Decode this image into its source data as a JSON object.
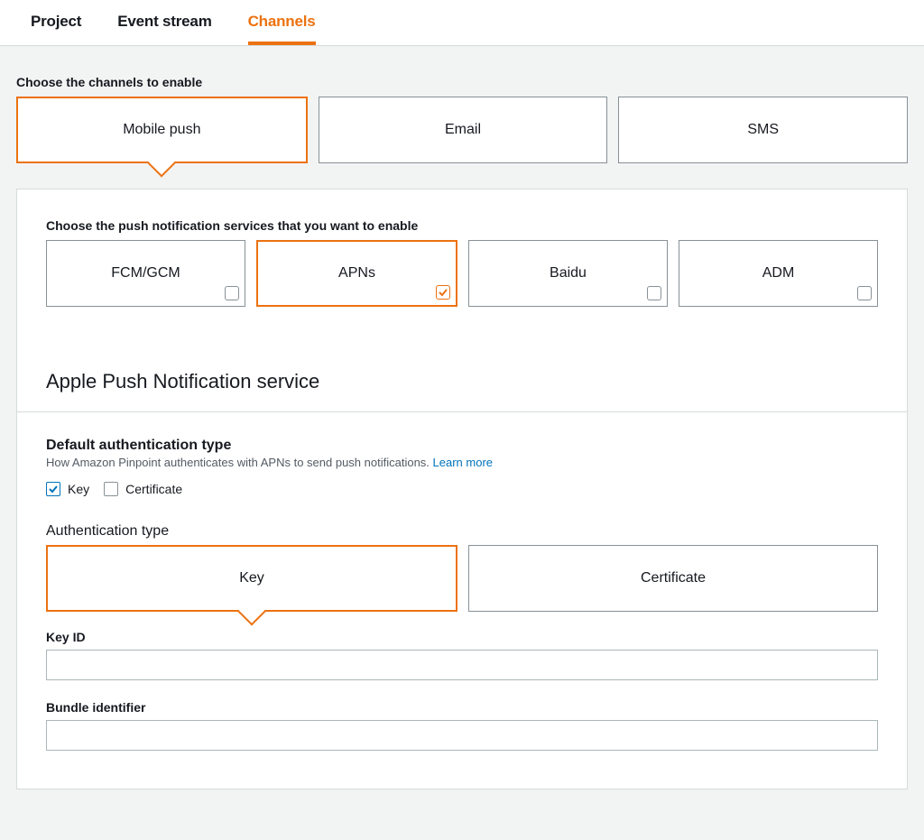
{
  "tabs": {
    "project": "Project",
    "event_stream": "Event stream",
    "channels": "Channels"
  },
  "channels": {
    "heading": "Choose the channels to enable",
    "mobile_push": "Mobile push",
    "email": "Email",
    "sms": "SMS"
  },
  "push_services": {
    "heading": "Choose the push notification services that you want to enable",
    "fcm": "FCM/GCM",
    "apns": "APNs",
    "baidu": "Baidu",
    "adm": "ADM"
  },
  "apns_section": {
    "title": "Apple Push Notification service",
    "default_auth_heading": "Default authentication type",
    "default_auth_desc": "How Amazon Pinpoint authenticates with APNs to send push notifications. ",
    "learn_more": "Learn more",
    "key_label": "Key",
    "certificate_label": "Certificate",
    "auth_type_heading": "Authentication type",
    "auth_key": "Key",
    "auth_certificate": "Certificate",
    "key_id_label": "Key ID",
    "key_id_value": "",
    "bundle_id_label": "Bundle identifier",
    "bundle_id_value": ""
  }
}
